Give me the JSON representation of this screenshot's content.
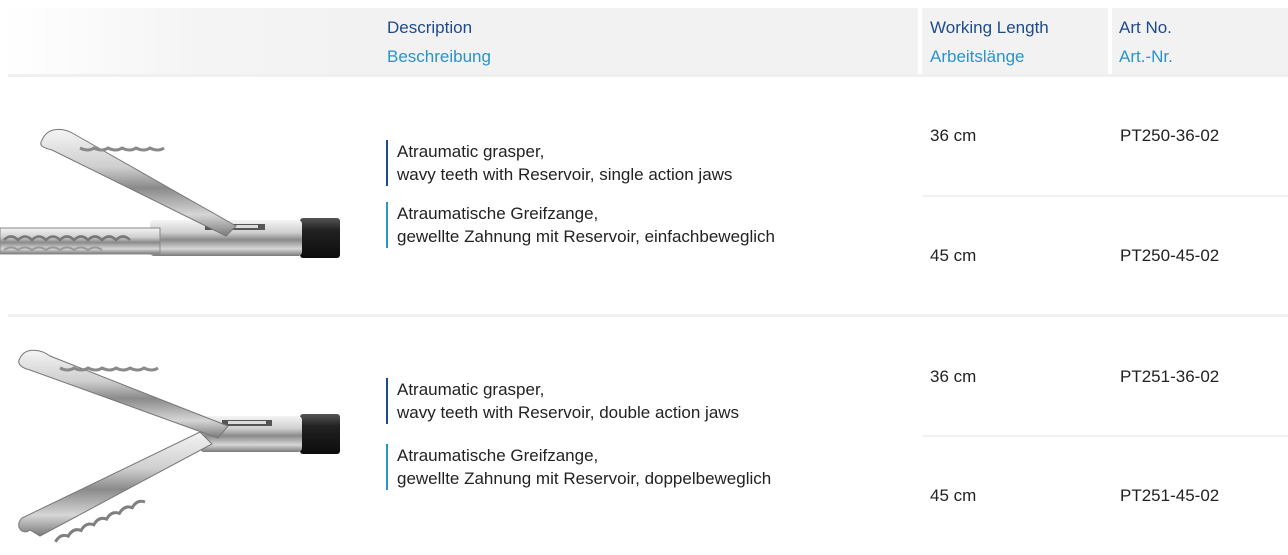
{
  "header": {
    "description_en": "Description",
    "description_de": "Beschreibung",
    "length_en": "Working Length",
    "length_de": "Arbeitslänge",
    "artno_en": "Art No.",
    "artno_de": "Art.-Nr."
  },
  "products": [
    {
      "image": "atraumatic-grasper-single-action-image",
      "desc_en_line1": "Atraumatic grasper,",
      "desc_en_line2": "wavy teeth with Reservoir, single action jaws",
      "desc_de_line1": "Atraumatische Greifzange,",
      "desc_de_line2": "gewellte Zahnung mit Reservoir, einfachbeweglich",
      "variants": [
        {
          "length": "36 cm",
          "artno": "PT250-36-02"
        },
        {
          "length": "45 cm",
          "artno": "PT250-45-02"
        }
      ]
    },
    {
      "image": "atraumatic-grasper-double-action-image",
      "desc_en_line1": "Atraumatic grasper,",
      "desc_en_line2": "wavy teeth with Reservoir, double action jaws",
      "desc_de_line1": "Atraumatische Greifzange,",
      "desc_de_line2": "gewellte Zahnung mit Reservoir, doppelbeweglich",
      "variants": [
        {
          "length": "36 cm",
          "artno": "PT251-36-02"
        },
        {
          "length": "45 cm",
          "artno": "PT251-45-02"
        }
      ]
    }
  ],
  "colors": {
    "heading_dark_blue": "#1e4b8c",
    "heading_light_blue": "#2a94c8",
    "header_bg": "#f2f2f2"
  }
}
